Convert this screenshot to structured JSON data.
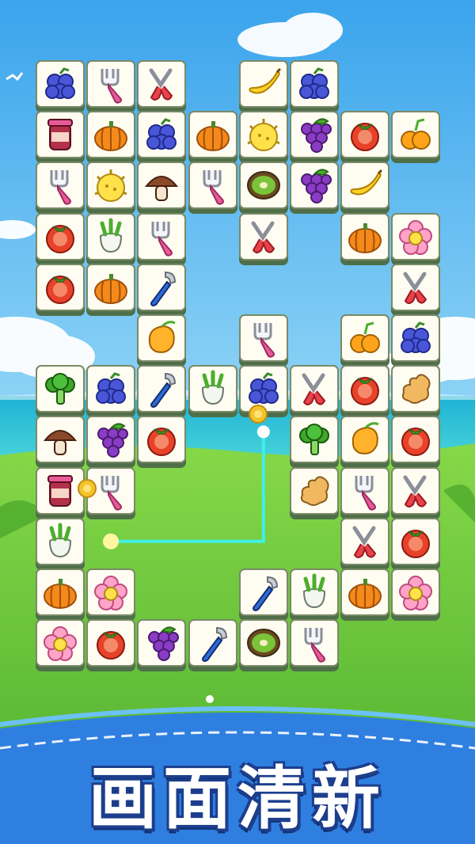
{
  "banner": {
    "title": "画面清新"
  },
  "colors": {
    "sky": "#4fb4f0",
    "sea": "#2ec5d8",
    "grass": "#6cc63a",
    "banner_blue": "#2f7fe0",
    "tile_face": "#fffdf2",
    "tile_base": "#4f6f4a",
    "link_line": "#3ff0e8",
    "coin": "#f3c32a"
  },
  "tiles": [
    {
      "col": 0,
      "row": 0,
      "icon": "grapes-icon"
    },
    {
      "col": 1,
      "row": 0,
      "icon": "fork-icon"
    },
    {
      "col": 2,
      "row": 0,
      "icon": "scissors-icon"
    },
    {
      "col": 4,
      "row": 0,
      "icon": "banana-icon"
    },
    {
      "col": 5,
      "row": 0,
      "icon": "grapes-icon"
    },
    {
      "col": 0,
      "row": 1,
      "icon": "jam-jar-icon"
    },
    {
      "col": 1,
      "row": 1,
      "icon": "pumpkin-icon"
    },
    {
      "col": 2,
      "row": 1,
      "icon": "grapes-icon"
    },
    {
      "col": 3,
      "row": 1,
      "icon": "pumpkin-icon"
    },
    {
      "col": 4,
      "row": 1,
      "icon": "durian-icon"
    },
    {
      "col": 5,
      "row": 1,
      "icon": "grape-bunch-icon"
    },
    {
      "col": 6,
      "row": 1,
      "icon": "tomato-icon"
    },
    {
      "col": 7,
      "row": 1,
      "icon": "orange-icon"
    },
    {
      "col": 0,
      "row": 2,
      "icon": "fork-icon"
    },
    {
      "col": 1,
      "row": 2,
      "icon": "durian-icon"
    },
    {
      "col": 2,
      "row": 2,
      "icon": "mushroom-icon"
    },
    {
      "col": 3,
      "row": 2,
      "icon": "fork-icon"
    },
    {
      "col": 4,
      "row": 2,
      "icon": "kiwi-icon"
    },
    {
      "col": 5,
      "row": 2,
      "icon": "grape-bunch-icon"
    },
    {
      "col": 6,
      "row": 2,
      "icon": "banana-icon"
    },
    {
      "col": 0,
      "row": 3,
      "icon": "tomato-icon"
    },
    {
      "col": 1,
      "row": 3,
      "icon": "radish-icon"
    },
    {
      "col": 2,
      "row": 3,
      "icon": "fork-icon"
    },
    {
      "col": 4,
      "row": 3,
      "icon": "scissors-icon"
    },
    {
      "col": 6,
      "row": 3,
      "icon": "pumpkin-icon"
    },
    {
      "col": 7,
      "row": 3,
      "icon": "flower-icon"
    },
    {
      "col": 0,
      "row": 4,
      "icon": "tomato-icon"
    },
    {
      "col": 1,
      "row": 4,
      "icon": "pumpkin-icon"
    },
    {
      "col": 2,
      "row": 4,
      "icon": "peeler-icon"
    },
    {
      "col": 7,
      "row": 4,
      "icon": "scissors-icon"
    },
    {
      "col": 2,
      "row": 5,
      "icon": "mango-icon"
    },
    {
      "col": 4,
      "row": 5,
      "icon": "fork-icon"
    },
    {
      "col": 6,
      "row": 5,
      "icon": "orange-icon"
    },
    {
      "col": 7,
      "row": 5,
      "icon": "grapes-icon"
    },
    {
      "col": 0,
      "row": 6,
      "icon": "broccoli-icon"
    },
    {
      "col": 1,
      "row": 6,
      "icon": "grapes-icon"
    },
    {
      "col": 2,
      "row": 6,
      "icon": "peeler-icon"
    },
    {
      "col": 3,
      "row": 6,
      "icon": "radish-icon"
    },
    {
      "col": 4,
      "row": 6,
      "icon": "grapes-icon"
    },
    {
      "col": 5,
      "row": 6,
      "icon": "scissors-icon"
    },
    {
      "col": 6,
      "row": 6,
      "icon": "tomato-icon"
    },
    {
      "col": 7,
      "row": 6,
      "icon": "ginger-icon"
    },
    {
      "col": 0,
      "row": 7,
      "icon": "mushroom-icon"
    },
    {
      "col": 1,
      "row": 7,
      "icon": "grape-bunch-icon"
    },
    {
      "col": 2,
      "row": 7,
      "icon": "tomato-icon"
    },
    {
      "col": 5,
      "row": 7,
      "icon": "broccoli-icon"
    },
    {
      "col": 6,
      "row": 7,
      "icon": "mango-icon"
    },
    {
      "col": 7,
      "row": 7,
      "icon": "tomato-icon"
    },
    {
      "col": 0,
      "row": 8,
      "icon": "jam-jar-icon"
    },
    {
      "col": 1,
      "row": 8,
      "icon": "fork-icon"
    },
    {
      "col": 5,
      "row": 8,
      "icon": "ginger-icon"
    },
    {
      "col": 6,
      "row": 8,
      "icon": "fork-icon"
    },
    {
      "col": 7,
      "row": 8,
      "icon": "scissors-icon"
    },
    {
      "col": 0,
      "row": 9,
      "icon": "radish-icon"
    },
    {
      "col": 6,
      "row": 9,
      "icon": "scissors-icon"
    },
    {
      "col": 7,
      "row": 9,
      "icon": "tomato-icon"
    },
    {
      "col": 0,
      "row": 10,
      "icon": "pumpkin-icon"
    },
    {
      "col": 1,
      "row": 10,
      "icon": "flower-icon"
    },
    {
      "col": 4,
      "row": 10,
      "icon": "peeler-icon"
    },
    {
      "col": 5,
      "row": 10,
      "icon": "radish-icon"
    },
    {
      "col": 6,
      "row": 10,
      "icon": "pumpkin-icon"
    },
    {
      "col": 7,
      "row": 10,
      "icon": "flower-icon"
    },
    {
      "col": 0,
      "row": 11,
      "icon": "flower-icon"
    },
    {
      "col": 1,
      "row": 11,
      "icon": "tomato-icon"
    },
    {
      "col": 2,
      "row": 11,
      "icon": "grape-bunch-icon"
    },
    {
      "col": 3,
      "row": 11,
      "icon": "peeler-icon"
    },
    {
      "col": 4,
      "row": 11,
      "icon": "kiwi-icon"
    },
    {
      "col": 5,
      "row": 11,
      "icon": "fork-icon"
    }
  ],
  "link_path": {
    "from_tile": {
      "col": 0,
      "row": 9
    },
    "to_tile": {
      "col": 4,
      "row": 7
    }
  }
}
